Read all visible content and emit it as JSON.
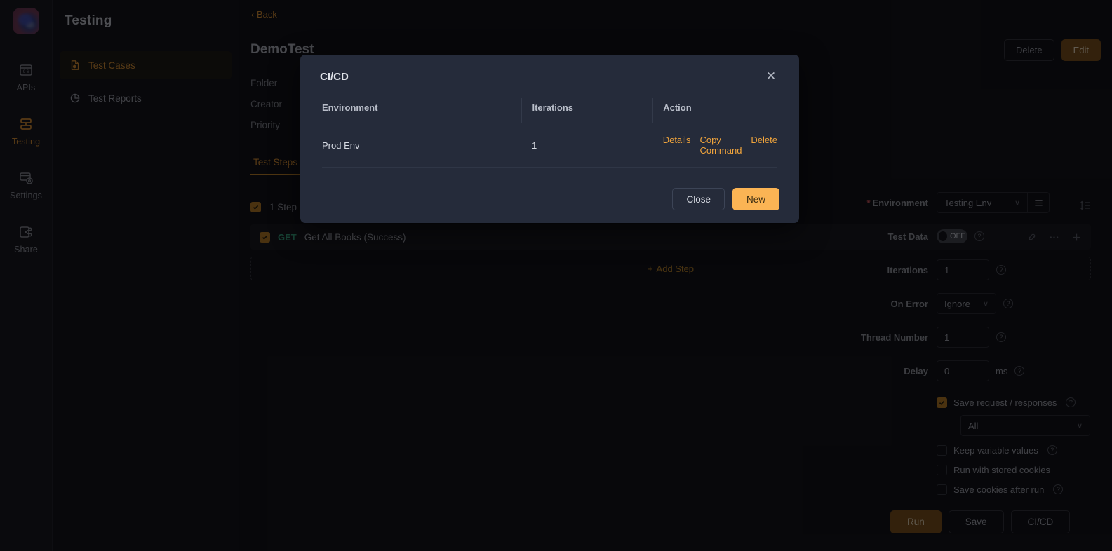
{
  "rail": {
    "logo_name": "app-logo",
    "items": [
      {
        "label": "APIs",
        "icon": "apis-icon",
        "active": false
      },
      {
        "label": "Testing",
        "icon": "testing-icon",
        "active": true
      },
      {
        "label": "Settings",
        "icon": "settings-icon",
        "active": false
      },
      {
        "label": "Share",
        "icon": "share-icon",
        "active": false
      }
    ]
  },
  "sidebar": {
    "title": "Testing",
    "items": [
      {
        "label": "Test Cases",
        "icon": "file-doc-icon",
        "active": true
      },
      {
        "label": "Test Reports",
        "icon": "pie-chart-icon",
        "active": false
      }
    ]
  },
  "main": {
    "back_label": "Back",
    "back_chevron": "‹",
    "page_title": "DemoTest",
    "meta_rows": [
      "Folder",
      "Creator",
      "Priority"
    ],
    "actions": {
      "delete_label": "Delete",
      "edit_label": "Edit"
    },
    "tabs": [
      {
        "label": "Test Steps",
        "active": true
      }
    ],
    "steps": {
      "count_label": "1 Step",
      "sort_icon": "sort-icon",
      "rows": [
        {
          "method": "GET",
          "name": "Get All Books (Success)",
          "method_color": "#2f8f6e",
          "icons": [
            "link-off-icon",
            "more-horizontal-icon",
            "plus-icon"
          ]
        }
      ],
      "add_step_label": "Add Step",
      "add_step_plus": "+"
    }
  },
  "config": {
    "environment": {
      "label": "Environment",
      "required_mark": "*",
      "value": "Testing Env",
      "menu_icon": "hamburger-icon"
    },
    "test_data": {
      "label": "Test Data",
      "state": "OFF"
    },
    "iterations": {
      "label": "Iterations",
      "value": "1"
    },
    "on_error": {
      "label": "On Error",
      "value": "Ignore"
    },
    "thread_number": {
      "label": "Thread Number",
      "value": "1"
    },
    "delay": {
      "label": "Delay",
      "value": "0",
      "unit": "ms"
    },
    "checkboxes": [
      {
        "label": "Save request / responses",
        "checked": true,
        "help": true
      },
      {
        "label": "Keep variable values",
        "checked": false,
        "help": true
      },
      {
        "label": "Run with stored cookies",
        "checked": false,
        "help": false
      },
      {
        "label": "Save cookies after run",
        "checked": false,
        "help": true
      }
    ],
    "save_scope": {
      "value": "All"
    },
    "buttons": {
      "run": "Run",
      "save": "Save",
      "cicd": "CI/CD"
    },
    "help_glyph": "?",
    "chevron_glyph": "∨"
  },
  "modal": {
    "title": "CI/CD",
    "close_glyph": "✕",
    "columns": [
      "Environment",
      "Iterations",
      "Action"
    ],
    "rows": [
      {
        "environment": "Prod Env",
        "iterations": "1",
        "actions": [
          "Details",
          "Copy Command",
          "Delete"
        ]
      }
    ],
    "buttons": {
      "close": "Close",
      "new": "New"
    },
    "accent_color": "#fbb454",
    "link_color": "#f0a43c",
    "background": "#252b3a"
  }
}
